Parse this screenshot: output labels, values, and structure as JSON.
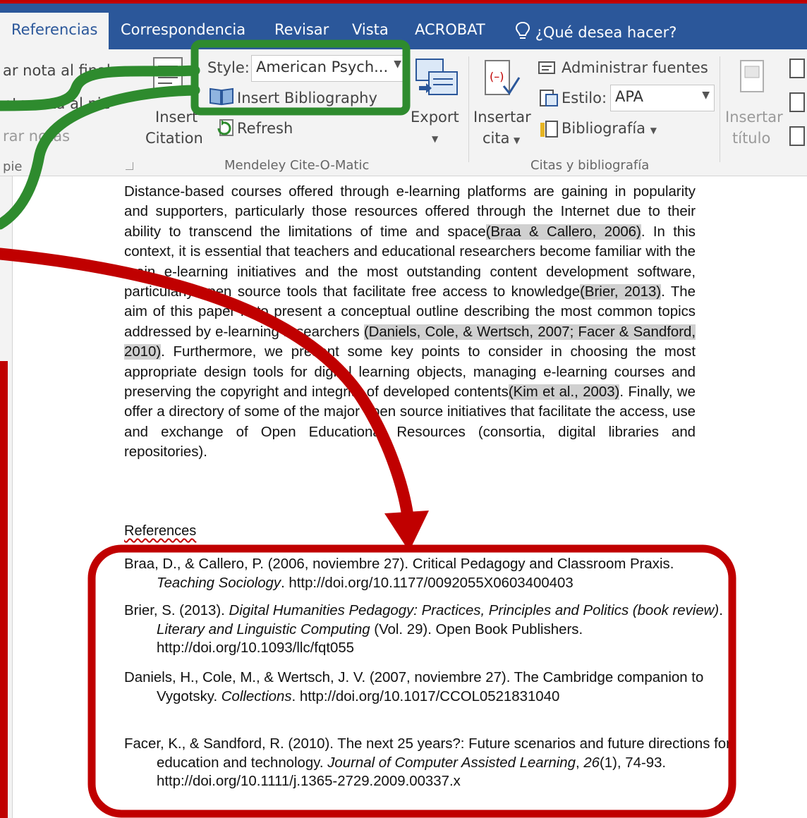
{
  "tabs": {
    "referencias": "Referencias",
    "correspondencia": "Correspondencia",
    "revisar": "Revisar",
    "vista": "Vista",
    "acrobat": "ACROBAT",
    "tell_me": "¿Qué desea hacer?"
  },
  "ribbon": {
    "footnotes": {
      "endnote": "ar nota al final",
      "next_footnote": "nte nota al pie",
      "show_notes": "rar notas",
      "group_label": "pie"
    },
    "mendeley": {
      "style_label": "Style:",
      "style_value": "American Psych...",
      "insert_bibliography": "Insert Bibliography",
      "insert_citation_line1": "Insert",
      "insert_citation_line2": "Citation",
      "refresh": "Refresh",
      "export": "Export",
      "group_label": "Mendeley Cite-O-Matic"
    },
    "citations": {
      "insert_line1": "Insertar",
      "insert_line2": "cita",
      "manage_sources": "Administrar fuentes",
      "style_label": "Estilo:",
      "style_value": "APA",
      "bibliography": "Bibliografía",
      "group_label": "Citas y bibliografía"
    },
    "captions": {
      "insert_line1": "Insertar",
      "insert_line2": "título"
    }
  },
  "document": {
    "paragraph": [
      {
        "t": "Distance-based courses offered through e-learning platforms are gaining in popularity and supporters, particularly those resources offered through the Internet due to their ability to transcend the limitations of time and space",
        "c": false
      },
      {
        "t": "(Braa & Callero, 2006)",
        "c": true
      },
      {
        "t": ". In this context, it is essential that teachers and educational researchers become familiar with the main e-learning initiatives and the most outstanding content development software, particularly open source tools that facilitate free access to knowledge",
        "c": false
      },
      {
        "t": "(Brier, 2013)",
        "c": true
      },
      {
        "t": ". The aim of this paper is to present a conceptual outline describing the most common topics addressed by e-learning researchers ",
        "c": false
      },
      {
        "t": "(Daniels, Cole, & Wertsch, 2007; Facer & Sandford, 2010)",
        "c": true
      },
      {
        "t": ". Furthermore, we present some key points to consider in choosing the most appropriate design tools for digital learning objects, managing e-learning courses and preserving the copyright and integrity of developed contents",
        "c": false
      },
      {
        "t": "(Kim et al., 2003)",
        "c": true
      },
      {
        "t": ". Finally, we offer a directory of some of the major open source initiatives that facilitate the access, use and exchange of Open Educational Resources (consortia, digital libraries and repositories).",
        "c": false
      }
    ],
    "references_heading": "References",
    "references": [
      [
        {
          "t": "Braa, D., & Callero, P. (2006, noviembre 27). Critical Pedagogy and Classroom Praxis. ",
          "i": false
        },
        {
          "t": "Teaching Sociology",
          "i": true
        },
        {
          "t": ". http://doi.org/10.1177/0092055X0603400403",
          "i": false
        }
      ],
      [
        {
          "t": "Brier, S. (2013). ",
          "i": false
        },
        {
          "t": "Digital Humanities Pedagogy: Practices, Principles and Politics (book review)",
          "i": true
        },
        {
          "t": ". ",
          "i": false
        },
        {
          "t": "Literary and Linguistic Computing",
          "i": true
        },
        {
          "t": " (Vol. 29). Open Book Publishers. http://doi.org/10.1093/llc/fqt055",
          "i": false
        }
      ],
      [
        {
          "t": "Daniels, H., Cole, M., & Wertsch, J. V. (2007, noviembre 27). The Cambridge companion to Vygotsky. ",
          "i": false
        },
        {
          "t": "Collections",
          "i": true
        },
        {
          "t": ". http://doi.org/10.1017/CCOL0521831040",
          "i": false
        }
      ],
      [
        {
          "t": "Facer, K., & Sandford, R. (2010). The next 25 years?: Future scenarios and future directions for education and technology. ",
          "i": false
        },
        {
          "t": "Journal of Computer Assisted Learning",
          "i": true
        },
        {
          "t": ", ",
          "i": false
        },
        {
          "t": "26",
          "i": true
        },
        {
          "t": "(1), 74-93. http://doi.org/10.1111/j.1365-2729.2009.00337.x",
          "i": false
        }
      ]
    ]
  },
  "colors": {
    "ribbon_blue": "#2b579a",
    "highlight_green": "#2e8b2e",
    "annotation_red": "#c00000",
    "citation_gray": "#d0d0d0"
  }
}
